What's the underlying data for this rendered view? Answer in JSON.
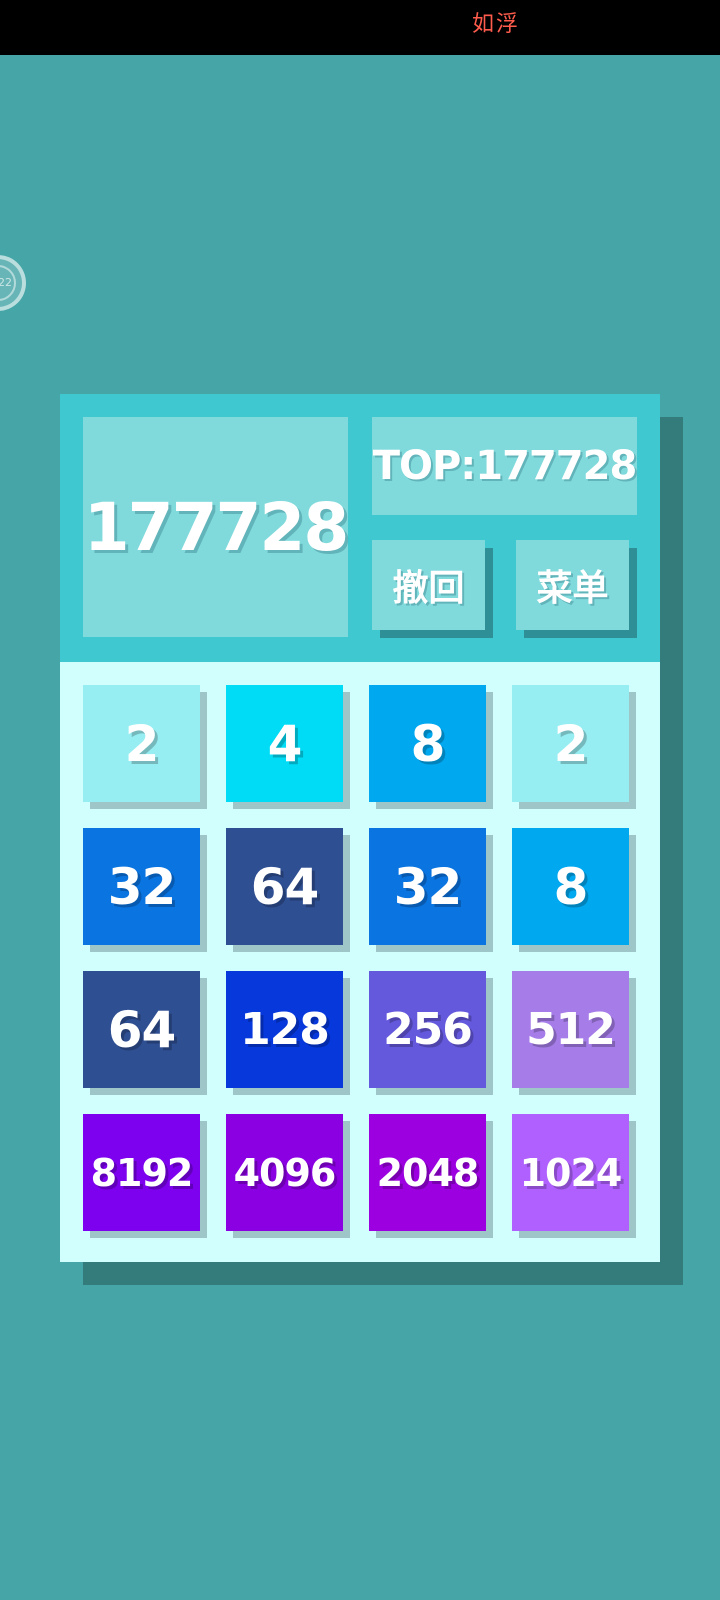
{
  "status_bar": {
    "center_text": "如浮",
    "bubble_text": "22"
  },
  "header": {
    "score": "177728",
    "top": "TOP:177728",
    "undo_label": "撤回",
    "menu_label": "菜单"
  },
  "colors": {
    "background": "#46a5a6",
    "header": "#3fc8d0",
    "panel": "#80dadc",
    "grid": "#d0fffd"
  },
  "tiles": [
    {
      "value": "2",
      "color": "#96eef2"
    },
    {
      "value": "4",
      "color": "#00dcf5"
    },
    {
      "value": "8",
      "color": "#00a8f0"
    },
    {
      "value": "2",
      "color": "#96eef2"
    },
    {
      "value": "32",
      "color": "#0a74e0"
    },
    {
      "value": "64",
      "color": "#2f4f93"
    },
    {
      "value": "32",
      "color": "#0a74e0"
    },
    {
      "value": "8",
      "color": "#00a8f0"
    },
    {
      "value": "64",
      "color": "#2f4f93"
    },
    {
      "value": "128",
      "color": "#0638dc"
    },
    {
      "value": "256",
      "color": "#6458dc"
    },
    {
      "value": "512",
      "color": "#a67de8"
    },
    {
      "value": "8192",
      "color": "#7d00ee"
    },
    {
      "value": "4096",
      "color": "#8b00e3"
    },
    {
      "value": "2048",
      "color": "#9c00e0"
    },
    {
      "value": "1024",
      "color": "#b060ff"
    }
  ]
}
